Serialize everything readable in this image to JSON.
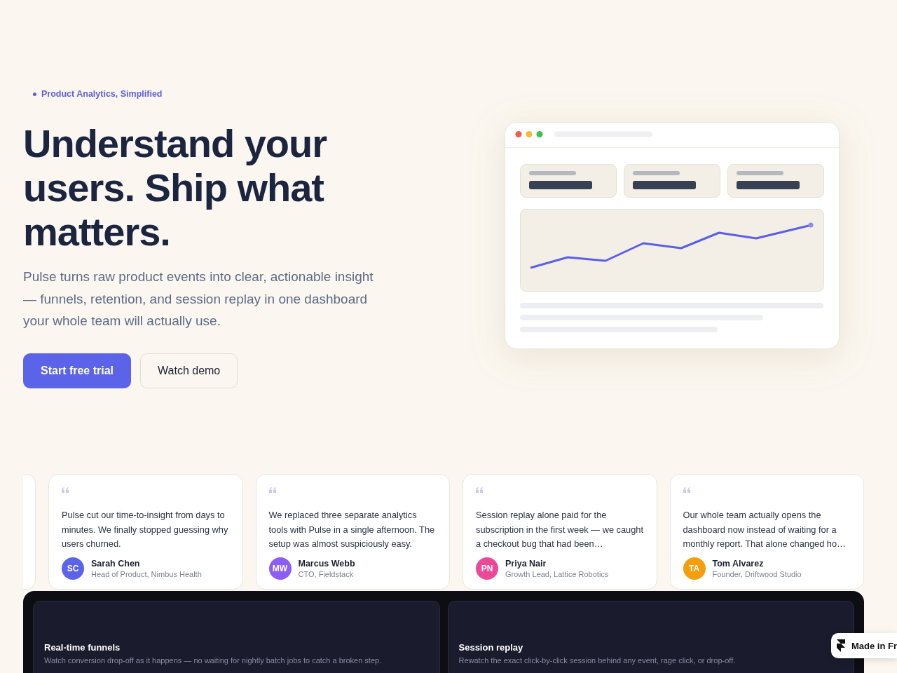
{
  "hero": {
    "eyebrow": {
      "text": "Product Analytics, Simplified"
    },
    "headline": "Understand your users. Ship what matters.",
    "subheadline": "Pulse turns raw product events into clear, actionable insight — funnels, retention, and session replay in one dashboard your whole team will actually use.",
    "buttons": [
      {
        "label": "Start free trial",
        "kind": "primary"
      },
      {
        "label": "Watch demo",
        "kind": "secondary"
      }
    ],
    "illustration": {
      "kind": "dashboard"
    }
  },
  "testimonials": {
    "clipped_card_before": true,
    "items": [
      {
        "quote": "Pulse cut our time-to-insight from days to minutes. We finally stopped guessing why users churned.",
        "initials": "SC",
        "color": "#5b63e8",
        "name": "Sarah Chen",
        "role": "Head of Product, Nimbus Health"
      },
      {
        "quote": "We replaced three separate analytics tools with Pulse in a single afternoon. The setup was almost suspiciously easy.",
        "initials": "MW",
        "color": "#8b5cf6",
        "name": "Marcus Webb",
        "role": "CTO, Fieldstack"
      },
      {
        "quote": "Session replay alone paid for the subscription in the first week — we caught a checkout bug that had been…",
        "initials": "PN",
        "color": "#ec4899",
        "name": "Priya Nair",
        "role": "Growth Lead, Lattice Robotics"
      },
      {
        "quote": "Our whole team actually opens the dashboard now instead of waiting for a monthly report. That alone changed ho…",
        "initials": "TA",
        "color": "#f59e0b",
        "name": "Tom Alvarez",
        "role": "Founder, Driftwood Studio"
      }
    ]
  },
  "features": [
    {
      "title": "Real-time funnels",
      "description": "Watch conversion drop-off as it happens — no waiting for nightly batch jobs to catch a broken step."
    },
    {
      "title": "Session replay",
      "description": "Rewatch the exact click-by-click session behind any event, rage click, or drop-off."
    }
  ],
  "badge": {
    "text": "Made in Fr"
  }
}
